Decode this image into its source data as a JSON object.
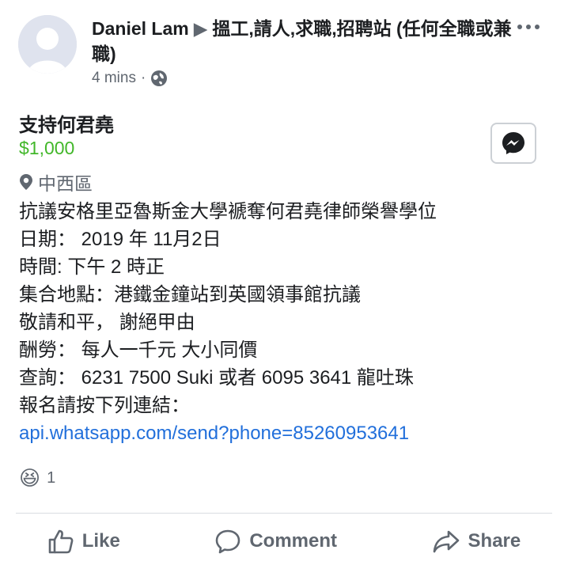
{
  "post": {
    "author": "Daniel Lam",
    "arrow": "▶",
    "group": "搵工,請人,求職,招聘站 (任何全職或兼職)",
    "time": "4 mins",
    "separator": "·"
  },
  "listing": {
    "title": "支持何君堯",
    "price": "$1,000",
    "location": "中西區"
  },
  "body_lines": [
    "抗議安格里亞魯斯金大學褫奪何君堯律師榮譽學位",
    "日期： 2019 年 11月2日",
    "時間: 下午 2 時正",
    "集合地點：港鐵金鐘站到英國領事館抗議",
    "敬請和平， 謝絕甲由",
    "酬勞： 每人一千元 大小同價",
    "查詢： 6231 7500 Suki 或者 6095 3641 龍吐珠",
    "報名請按下列連結："
  ],
  "link": "api.whatsapp.com/send?phone=85260953641",
  "reactions": {
    "count": "1",
    "emoji": "😆"
  },
  "actions": {
    "like": "Like",
    "comment": "Comment",
    "share": "Share"
  },
  "colors": {
    "price": "#42b72a",
    "link": "#216fdb",
    "muted": "#606770"
  },
  "icons": [
    "more-options-icon",
    "globe-icon",
    "location-pin-icon",
    "messenger-icon",
    "haha-reaction-icon",
    "like-icon",
    "comment-icon",
    "share-icon"
  ]
}
